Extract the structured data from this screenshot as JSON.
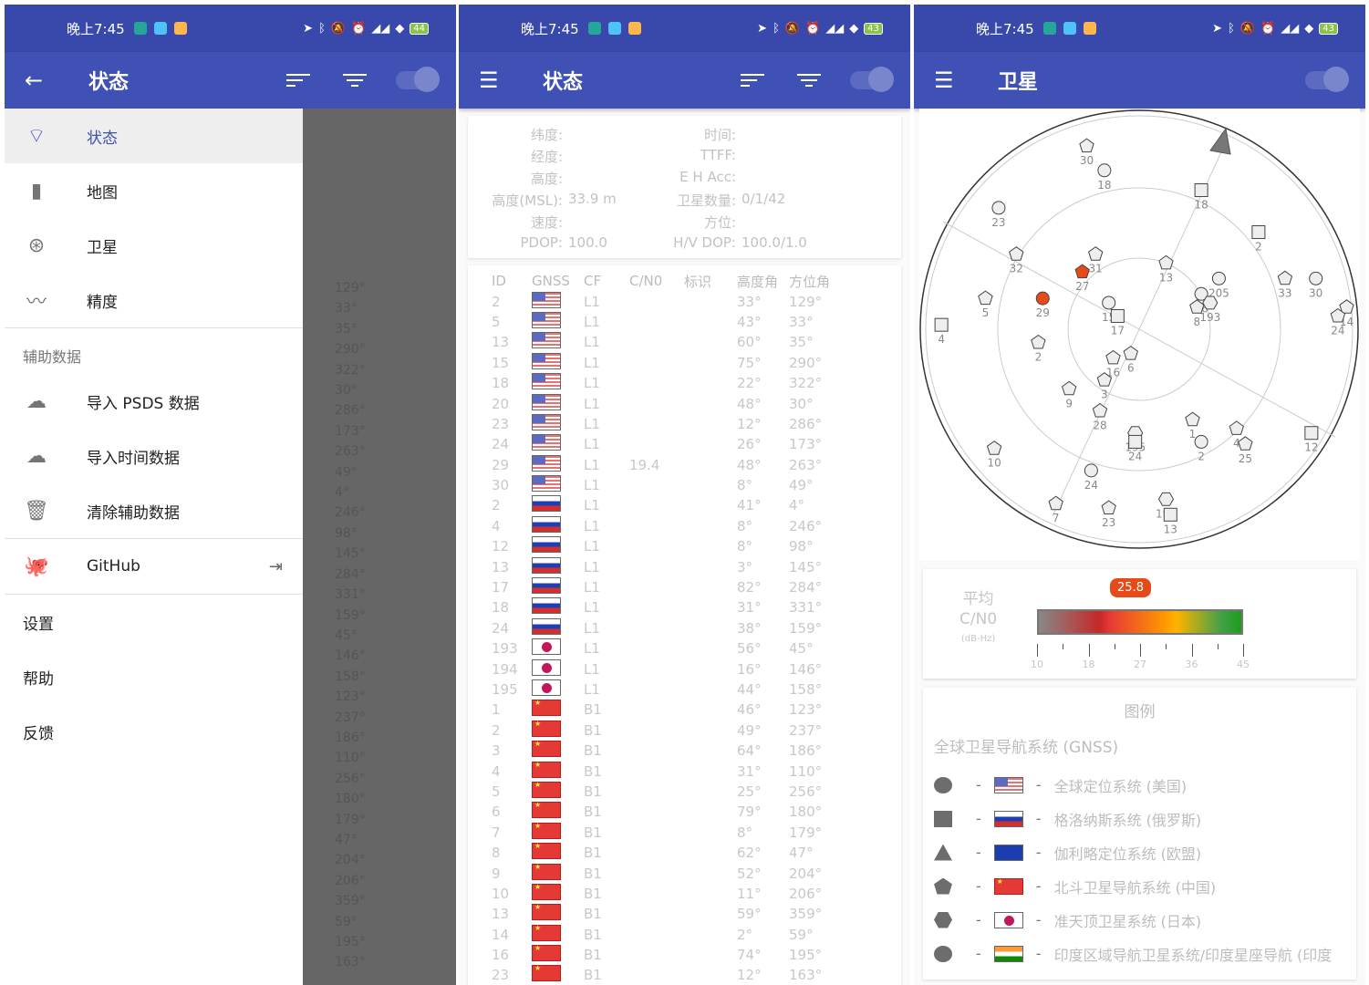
{
  "status_bar": [
    {
      "time": "晚上7:45",
      "battery": "44"
    },
    {
      "time": "晚上7:45",
      "battery": "43"
    },
    {
      "time": "晚上7:45",
      "battery": "43"
    }
  ],
  "panel1": {
    "appbar": {
      "nav_icon": "arrow-back-icon",
      "title": "状态"
    },
    "drawer": {
      "main_items": [
        {
          "label": "状态",
          "icon": "gps-signal-icon",
          "selected": true
        },
        {
          "label": "地图",
          "icon": "map-icon"
        },
        {
          "label": "卫星",
          "icon": "satellite-icon"
        },
        {
          "label": "精度",
          "icon": "accuracy-chart-icon"
        }
      ],
      "assist_header": "辅助数据",
      "assist_items": [
        {
          "label": "导入 PSDS 数据",
          "icon": "cloud-download-icon"
        },
        {
          "label": "导入时间数据",
          "icon": "cloud-time-icon"
        },
        {
          "label": "清除辅助数据",
          "icon": "trash-icon"
        }
      ],
      "github": {
        "label": "GitHub",
        "icon": "github-icon",
        "trail_icon": "open-external-icon"
      },
      "bottom_items": [
        "设置",
        "帮助",
        "反馈"
      ]
    },
    "scrim_az": [
      "129°",
      "33°",
      "35°",
      "290°",
      "322°",
      "30°",
      "286°",
      "173°",
      "263°",
      "49°",
      "4°",
      "246°",
      "98°",
      "145°",
      "284°",
      "331°",
      "159°",
      "45°",
      "146°",
      "158°",
      "123°",
      "237°",
      "186°",
      "110°",
      "256°",
      "180°",
      "179°",
      "47°",
      "204°",
      "206°",
      "359°",
      "59°",
      "195°",
      "163°"
    ]
  },
  "panel2": {
    "appbar": {
      "nav_icon": "menu-icon",
      "title": "状态"
    },
    "info": [
      {
        "l1": "纬度:",
        "v1": "",
        "l2": "时间:",
        "v2": ""
      },
      {
        "l1": "经度:",
        "v1": "",
        "l2": "TTFF:",
        "v2": ""
      },
      {
        "l1": "高度:",
        "v1": "",
        "l2": "E H Acc:",
        "v2": ""
      },
      {
        "l1": "高度(MSL):",
        "v1": "33.9 m",
        "l2": "卫星数量:",
        "v2": "0/1/42"
      },
      {
        "l1": "速度:",
        "v1": "",
        "l2": "方位:",
        "v2": ""
      },
      {
        "l1": "PDOP:",
        "v1": "100.0",
        "l2": "H/V DOP:",
        "v2": "100.0/1.0"
      }
    ],
    "table_headers": [
      "ID",
      "GNSS",
      "CF",
      "C/N0",
      "标识",
      "高度角",
      "方位角"
    ],
    "rows": [
      {
        "id": "2",
        "gnss": "us",
        "cf": "L1",
        "cn0": "",
        "flags": "",
        "el": "33°",
        "az": "129°"
      },
      {
        "id": "5",
        "gnss": "us",
        "cf": "L1",
        "cn0": "",
        "flags": "",
        "el": "43°",
        "az": "33°"
      },
      {
        "id": "13",
        "gnss": "us",
        "cf": "L1",
        "cn0": "",
        "flags": "",
        "el": "60°",
        "az": "35°"
      },
      {
        "id": "15",
        "gnss": "us",
        "cf": "L1",
        "cn0": "",
        "flags": "",
        "el": "75°",
        "az": "290°"
      },
      {
        "id": "18",
        "gnss": "us",
        "cf": "L1",
        "cn0": "",
        "flags": "",
        "el": "22°",
        "az": "322°"
      },
      {
        "id": "20",
        "gnss": "us",
        "cf": "L1",
        "cn0": "",
        "flags": "",
        "el": "48°",
        "az": "30°"
      },
      {
        "id": "23",
        "gnss": "us",
        "cf": "L1",
        "cn0": "",
        "flags": "",
        "el": "12°",
        "az": "286°"
      },
      {
        "id": "24",
        "gnss": "us",
        "cf": "L1",
        "cn0": "",
        "flags": "",
        "el": "26°",
        "az": "173°"
      },
      {
        "id": "29",
        "gnss": "us",
        "cf": "L1",
        "cn0": "19.4",
        "flags": "",
        "el": "48°",
        "az": "263°"
      },
      {
        "id": "30",
        "gnss": "us",
        "cf": "L1",
        "cn0": "",
        "flags": "",
        "el": "8°",
        "az": "49°"
      },
      {
        "id": "2",
        "gnss": "ru",
        "cf": "L1",
        "cn0": "",
        "flags": "",
        "el": "41°",
        "az": "4°"
      },
      {
        "id": "4",
        "gnss": "ru",
        "cf": "L1",
        "cn0": "",
        "flags": "",
        "el": "8°",
        "az": "246°"
      },
      {
        "id": "12",
        "gnss": "ru",
        "cf": "L1",
        "cn0": "",
        "flags": "",
        "el": "8°",
        "az": "98°"
      },
      {
        "id": "13",
        "gnss": "ru",
        "cf": "L1",
        "cn0": "",
        "flags": "",
        "el": "3°",
        "az": "145°"
      },
      {
        "id": "17",
        "gnss": "ru",
        "cf": "L1",
        "cn0": "",
        "flags": "",
        "el": "82°",
        "az": "284°"
      },
      {
        "id": "18",
        "gnss": "ru",
        "cf": "L1",
        "cn0": "",
        "flags": "",
        "el": "31°",
        "az": "331°"
      },
      {
        "id": "24",
        "gnss": "ru",
        "cf": "L1",
        "cn0": "",
        "flags": "",
        "el": "38°",
        "az": "159°"
      },
      {
        "id": "193",
        "gnss": "jp",
        "cf": "L1",
        "cn0": "",
        "flags": "",
        "el": "56°",
        "az": "45°"
      },
      {
        "id": "194",
        "gnss": "jp",
        "cf": "L1",
        "cn0": "",
        "flags": "",
        "el": "16°",
        "az": "146°"
      },
      {
        "id": "195",
        "gnss": "jp",
        "cf": "L1",
        "cn0": "",
        "flags": "",
        "el": "44°",
        "az": "158°"
      },
      {
        "id": "1",
        "gnss": "cn",
        "cf": "B1",
        "cn0": "",
        "flags": "",
        "el": "46°",
        "az": "123°"
      },
      {
        "id": "2",
        "gnss": "cn",
        "cf": "B1",
        "cn0": "",
        "flags": "",
        "el": "49°",
        "az": "237°"
      },
      {
        "id": "3",
        "gnss": "cn",
        "cf": "B1",
        "cn0": "",
        "flags": "",
        "el": "64°",
        "az": "186°"
      },
      {
        "id": "4",
        "gnss": "cn",
        "cf": "B1",
        "cn0": "",
        "flags": "",
        "el": "31°",
        "az": "110°"
      },
      {
        "id": "5",
        "gnss": "cn",
        "cf": "B1",
        "cn0": "",
        "flags": "",
        "el": "25°",
        "az": "256°"
      },
      {
        "id": "6",
        "gnss": "cn",
        "cf": "B1",
        "cn0": "",
        "flags": "",
        "el": "79°",
        "az": "180°"
      },
      {
        "id": "7",
        "gnss": "cn",
        "cf": "B1",
        "cn0": "",
        "flags": "",
        "el": "8°",
        "az": "179°"
      },
      {
        "id": "8",
        "gnss": "cn",
        "cf": "B1",
        "cn0": "",
        "flags": "",
        "el": "62°",
        "az": "47°"
      },
      {
        "id": "9",
        "gnss": "cn",
        "cf": "B1",
        "cn0": "",
        "flags": "",
        "el": "52°",
        "az": "204°"
      },
      {
        "id": "10",
        "gnss": "cn",
        "cf": "B1",
        "cn0": "",
        "flags": "",
        "el": "11°",
        "az": "206°"
      },
      {
        "id": "13",
        "gnss": "cn",
        "cf": "B1",
        "cn0": "",
        "flags": "",
        "el": "59°",
        "az": "359°"
      },
      {
        "id": "14",
        "gnss": "cn",
        "cf": "B1",
        "cn0": "",
        "flags": "",
        "el": "2°",
        "az": "59°"
      },
      {
        "id": "16",
        "gnss": "cn",
        "cf": "B1",
        "cn0": "",
        "flags": "",
        "el": "74°",
        "az": "195°"
      },
      {
        "id": "23",
        "gnss": "cn",
        "cf": "B1",
        "cn0": "",
        "flags": "",
        "el": "12°",
        "az": "163°"
      }
    ]
  },
  "panel3": {
    "appbar": {
      "nav_icon": "menu-icon",
      "title": "卫星"
    },
    "sky": {
      "satellites": [
        {
          "label": "30",
          "shape": "pentagon",
          "used": false,
          "ex": 0.38,
          "ey": -0.83
        },
        {
          "label": "18",
          "shape": "circle",
          "used": false,
          "ex": 0.42,
          "ey": -0.72
        },
        {
          "label": "18",
          "shape": "square",
          "used": false,
          "ex": 0.64,
          "ey": -0.63
        },
        {
          "label": "23",
          "shape": "circle",
          "used": false,
          "ex": 0.18,
          "ey": -0.55
        },
        {
          "label": "2",
          "shape": "square",
          "used": false,
          "ex": 0.77,
          "ey": -0.44
        },
        {
          "label": "32",
          "shape": "pentagon",
          "used": false,
          "ex": 0.22,
          "ey": -0.34
        },
        {
          "label": "31",
          "shape": "pentagon",
          "used": false,
          "ex": 0.4,
          "ey": -0.34
        },
        {
          "label": "27",
          "shape": "pentagon",
          "used": true,
          "ex": 0.37,
          "ey": -0.26
        },
        {
          "label": "13",
          "shape": "pentagon",
          "used": false,
          "ex": 0.56,
          "ey": -0.3
        },
        {
          "label": "29",
          "shape": "circle",
          "used": true,
          "ex": 0.28,
          "ey": -0.14
        },
        {
          "label": "5",
          "shape": "pentagon",
          "used": false,
          "ex": 0.15,
          "ey": -0.14
        },
        {
          "label": "15",
          "shape": "circle",
          "used": false,
          "ex": 0.43,
          "ey": -0.12
        },
        {
          "label": "17",
          "shape": "square",
          "used": false,
          "ex": 0.45,
          "ey": -0.06
        },
        {
          "label": "4",
          "shape": "square",
          "used": false,
          "ex": 0.05,
          "ey": -0.02
        },
        {
          "label": "2",
          "shape": "pentagon",
          "used": false,
          "ex": 0.27,
          "ey": 0.06
        },
        {
          "label": "205",
          "shape": "circle",
          "used": false,
          "ex": 0.68,
          "ey": -0.23
        },
        {
          "label": "16",
          "shape": "circle",
          "used": false,
          "ex": 0.64,
          "ey": -0.16
        },
        {
          "label": "193",
          "shape": "hexagon",
          "used": false,
          "ex": 0.66,
          "ey": -0.12
        },
        {
          "label": "8",
          "shape": "pentagon",
          "used": false,
          "ex": 0.63,
          "ey": -0.1
        },
        {
          "label": "33",
          "shape": "pentagon",
          "used": false,
          "ex": 0.83,
          "ey": -0.23
        },
        {
          "label": "30",
          "shape": "circle",
          "used": false,
          "ex": 0.9,
          "ey": -0.23
        },
        {
          "label": "14",
          "shape": "pentagon",
          "used": false,
          "ex": 0.97,
          "ey": -0.1
        },
        {
          "label": "24",
          "shape": "pentagon",
          "used": false,
          "ex": 0.95,
          "ey": -0.06
        },
        {
          "label": "6",
          "shape": "pentagon",
          "used": false,
          "ex": 0.48,
          "ey": 0.11
        },
        {
          "label": "16",
          "shape": "pentagon",
          "used": false,
          "ex": 0.44,
          "ey": 0.13
        },
        {
          "label": "3",
          "shape": "pentagon",
          "used": false,
          "ex": 0.42,
          "ey": 0.23
        },
        {
          "label": "9",
          "shape": "pentagon",
          "used": false,
          "ex": 0.34,
          "ey": 0.27
        },
        {
          "label": "28",
          "shape": "pentagon",
          "used": false,
          "ex": 0.41,
          "ey": 0.37
        },
        {
          "label": "1",
          "shape": "pentagon",
          "used": false,
          "ex": 0.62,
          "ey": 0.41
        },
        {
          "label": "4",
          "shape": "pentagon",
          "used": false,
          "ex": 0.72,
          "ey": 0.45
        },
        {
          "label": "2",
          "shape": "circle",
          "used": false,
          "ex": 0.64,
          "ey": 0.51
        },
        {
          "label": "25",
          "shape": "pentagon",
          "used": false,
          "ex": 0.74,
          "ey": 0.52
        },
        {
          "label": "12",
          "shape": "square",
          "used": false,
          "ex": 0.89,
          "ey": 0.47
        },
        {
          "label": "195",
          "shape": "hexagon",
          "used": false,
          "ex": 0.49,
          "ey": 0.47
        },
        {
          "label": "24",
          "shape": "square",
          "used": false,
          "ex": 0.49,
          "ey": 0.51
        },
        {
          "label": "10",
          "shape": "pentagon",
          "used": false,
          "ex": 0.17,
          "ey": 0.54
        },
        {
          "label": "24",
          "shape": "circle",
          "used": false,
          "ex": 0.39,
          "ey": 0.64
        },
        {
          "label": "7",
          "shape": "pentagon",
          "used": false,
          "ex": 0.31,
          "ey": 0.79
        },
        {
          "label": "23",
          "shape": "pentagon",
          "used": false,
          "ex": 0.43,
          "ey": 0.81
        },
        {
          "label": "194",
          "shape": "hexagon",
          "used": false,
          "ex": 0.56,
          "ey": 0.77
        },
        {
          "label": "13",
          "shape": "square",
          "used": false,
          "ex": 0.57,
          "ey": 0.84
        }
      ]
    },
    "cn0": {
      "title_line1": "平均",
      "title_line2": "C/N0",
      "unit": "(dB-Hz)",
      "value": "25.8",
      "value_num": 25.8,
      "min": 10,
      "max": 45,
      "tick_labels": [
        "10",
        "18",
        "27",
        "36",
        "45"
      ]
    },
    "legend": {
      "title": "图例",
      "subtitle": "全球卫星导航系统 (GNSS)",
      "items": [
        {
          "shape": "circle",
          "flag": "us",
          "label": "全球定位系统 (美国)"
        },
        {
          "shape": "square",
          "flag": "ru",
          "label": "格洛纳斯系统 (俄罗斯)"
        },
        {
          "shape": "triangle",
          "flag": "eu",
          "label": "伽利略定位系统 (欧盟)"
        },
        {
          "shape": "pentagon",
          "flag": "cn",
          "label": "北斗卫星导航系统 (中国)"
        },
        {
          "shape": "hexagon",
          "flag": "jp",
          "label": "准天顶卫星系统 (日本)"
        },
        {
          "shape": "oval",
          "flag": "in",
          "label": "印度区域导航卫星系统/印度星座导航 (印度"
        }
      ],
      "dash": "-"
    }
  },
  "colors": {
    "primary": "#3f51b5",
    "status": "#3949ab",
    "used_sat": "#e64a19"
  }
}
